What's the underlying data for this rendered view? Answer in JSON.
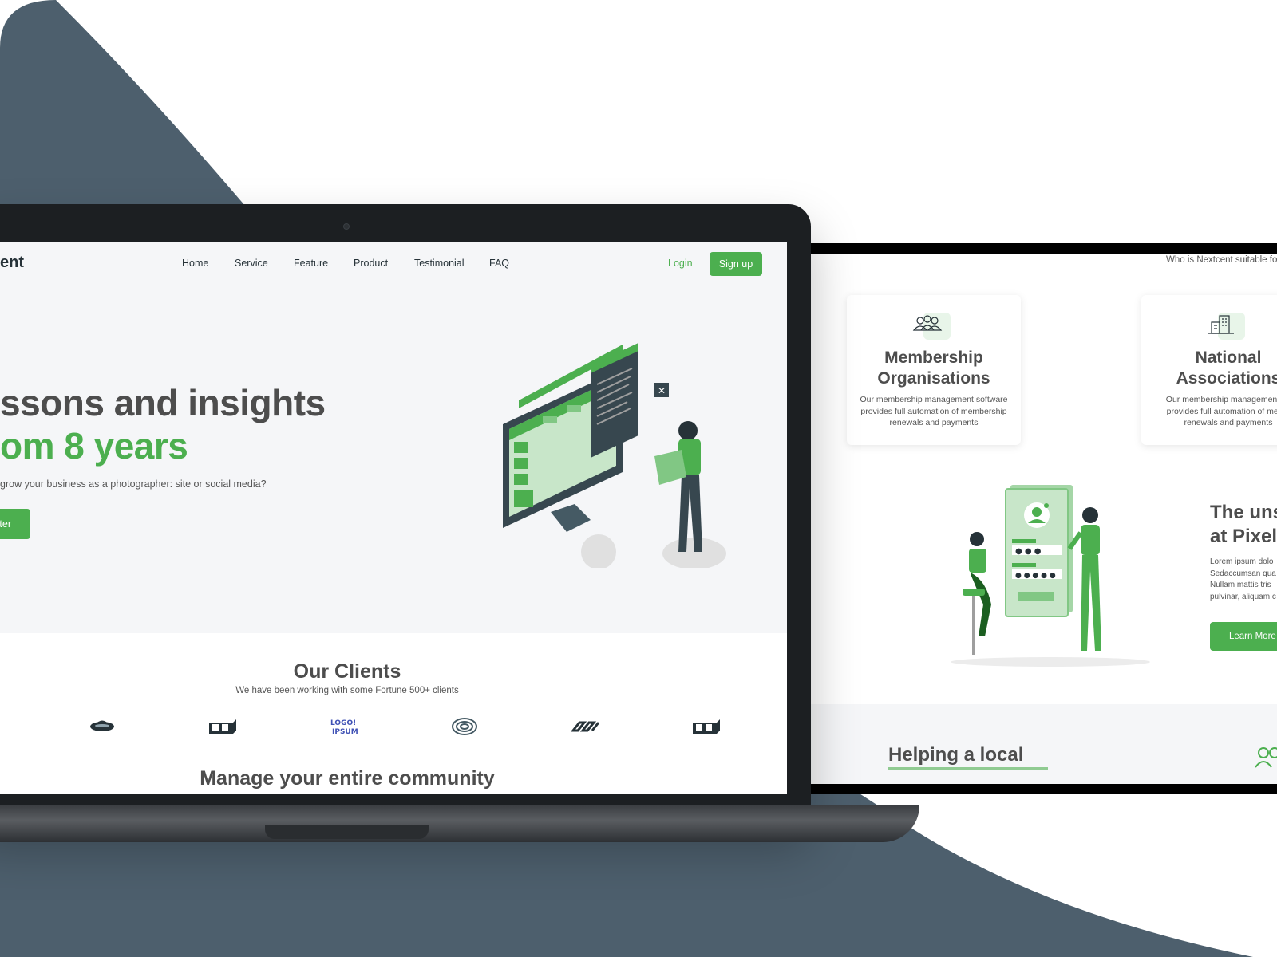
{
  "colors": {
    "accent": "#4caf4f",
    "dark_bg": "#4d5f6d",
    "heading": "#4d4d4d",
    "screen_bg": "#f5f6f8"
  },
  "laptop": {
    "nav": {
      "brand": "ent",
      "links": [
        "Home",
        "Service",
        "Feature",
        "Product",
        "Testimonial",
        "FAQ"
      ],
      "login": "Login",
      "signup": "Sign up"
    },
    "hero": {
      "line1": "ssons and insights",
      "line2": "om 8 years",
      "subtitle": "grow your business as a photographer: site or social media?",
      "button": "ter",
      "illustration_icon": "developer-at-monitor-illustration"
    },
    "clients": {
      "title": "Our Clients",
      "subtitle": "We have been working with some Fortune 500+ clients",
      "logos": [
        "saucer-logo-icon",
        "cube-logo-icon",
        "logoipsum-logo-icon",
        "spiral-logo-icon",
        "chain-logo-icon",
        "cube-logo-icon"
      ],
      "logo_text": "LOGO IPSUM"
    },
    "manage_title": "Manage your entire community"
  },
  "screen2": {
    "tagline": "Who is Nextcent suitable fo",
    "cards": [
      {
        "title_line1": "Membership",
        "title_line2": "Organisations",
        "desc": "Our membership management software provides full automation of membership renewals and payments",
        "icon": "people-group-icon"
      },
      {
        "title_line1": "National",
        "title_line2": "Associations",
        "desc": "Our membership management so provides full automation of memb renewals and payments",
        "icon": "building-icon"
      }
    ],
    "section": {
      "heading_line1": "The uns",
      "heading_line2": "at Pixel",
      "para": [
        "Lorem ipsum dolo",
        "Sedaccumsan qua",
        "Nullam mattis tris",
        "pulvinar, aliquam c"
      ],
      "button": "Learn More",
      "illustration_icon": "login-screen-illustration"
    },
    "band": {
      "title": "Helping a local",
      "icon": "users-icon"
    }
  }
}
